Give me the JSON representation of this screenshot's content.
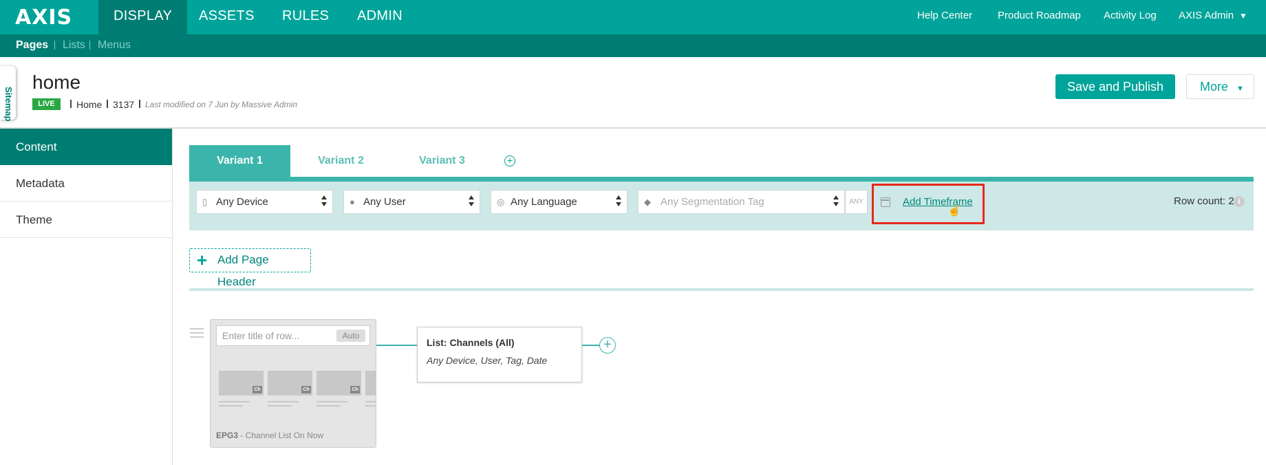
{
  "app": {
    "logo": "AXIS",
    "nav_tabs": [
      {
        "label": "DISPLAY",
        "active": true
      },
      {
        "label": "ASSETS"
      },
      {
        "label": "RULES"
      },
      {
        "label": "ADMIN"
      }
    ],
    "top_links": [
      "Help Center",
      "Product Roadmap",
      "Activity Log"
    ],
    "user_menu": "AXIS Admin",
    "subnav": [
      "Pages",
      "Lists",
      "Menus"
    ],
    "accent_color": "#00a49a"
  },
  "page": {
    "sitemap_tab": "Sitemap",
    "title": "home",
    "status": "LIVE",
    "name": "Home",
    "id": "3137",
    "modified": "Last modified on 7 Jun by Massive Admin",
    "publish_button": "Save and Publish",
    "more_button": "More"
  },
  "sidebar": {
    "items": [
      "Content",
      "Metadata",
      "Theme"
    ]
  },
  "variants": {
    "tabs": [
      "Variant 1",
      "Variant 2",
      "Variant 3"
    ],
    "add_icon": "+"
  },
  "filters": {
    "device": "Any Device",
    "user": "Any User",
    "language": "Any Language",
    "segmentation_placeholder": "Any Segmentation Tag",
    "any_tag": "ANY",
    "add_timeframe": "Add Timeframe",
    "row_count": "Row count: 2",
    "info": "i"
  },
  "content": {
    "add_page_header": "Add Page Header",
    "row": {
      "title_placeholder": "Enter title of row...",
      "auto_button": "Auto",
      "thumb_badge": "Ch",
      "template_code": "EPG3",
      "template_name": " - Channel List On Now"
    },
    "list": {
      "title": "List: Channels (All)",
      "subtitle": "Any Device, User, Tag, Date",
      "add_icon": "+"
    }
  }
}
